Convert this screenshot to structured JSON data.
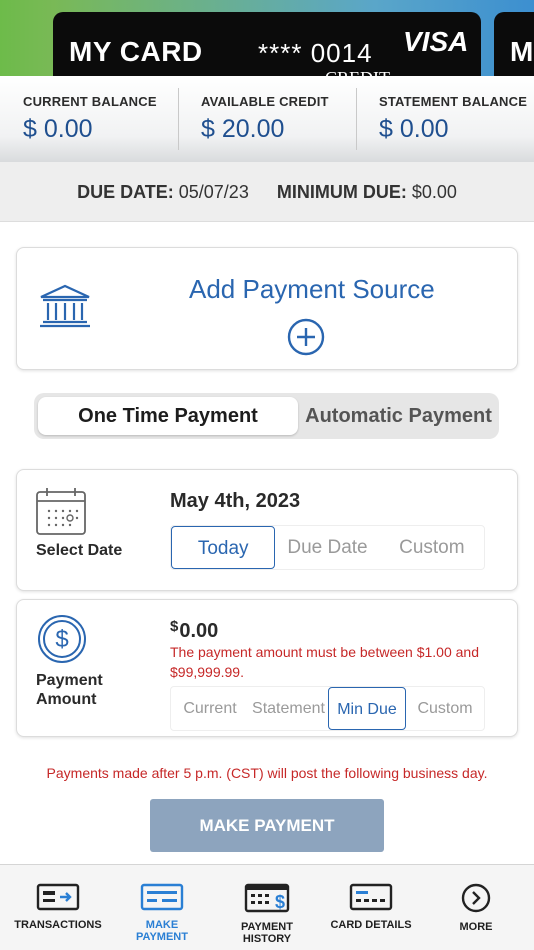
{
  "card": {
    "name": "MY CARD",
    "number": "**** 0014",
    "brand": "VISA",
    "sub": "CREDIT",
    "next_card_initial": "M"
  },
  "balances": [
    {
      "label": "CURRENT BALANCE",
      "value": "$ 0.00"
    },
    {
      "label": "AVAILABLE CREDIT",
      "value": "$ 20.00"
    },
    {
      "label": "STATEMENT BALANCE",
      "value": "$ 0.00"
    }
  ],
  "due": {
    "due_date_label": "DUE DATE:",
    "due_date_value": "05/07/23",
    "min_due_label": "MINIMUM DUE:",
    "min_due_value": "$0.00"
  },
  "add_source": {
    "title": "Add Payment Source",
    "icon": "bank-icon"
  },
  "payment_type": {
    "options": [
      "One Time Payment",
      "Automatic Payment"
    ],
    "selected": "One Time Payment"
  },
  "date_section": {
    "label": "Select Date",
    "value": "May 4th, 2023",
    "options": [
      "Today",
      "Due Date",
      "Custom"
    ],
    "selected": "Today"
  },
  "amount_section": {
    "label": "Payment Amount",
    "currency": "$",
    "value": "0.00",
    "error": "The payment amount must be between $1.00 and $99,999.99.",
    "options": [
      "Current",
      "Statement",
      "Min Due",
      "Custom"
    ],
    "selected": "Min Due"
  },
  "notice": "Payments made after 5 p.m. (CST) will post the following business day.",
  "make_payment_label": "MAKE PAYMENT",
  "nav": [
    {
      "label": "TRANSACTIONS",
      "icon": "transactions-icon"
    },
    {
      "label": "MAKE PAYMENT",
      "icon": "make-payment-icon",
      "active": true
    },
    {
      "label": "PAYMENT HISTORY",
      "icon": "payment-history-icon"
    },
    {
      "label": "CARD DETAILS",
      "icon": "card-details-icon"
    },
    {
      "label": "MORE",
      "icon": "more-icon"
    }
  ],
  "colors": {
    "accent": "#2a66b0",
    "error": "#c62828",
    "button_disabled": "#8da4be",
    "nav_active": "#2a7fd4"
  }
}
